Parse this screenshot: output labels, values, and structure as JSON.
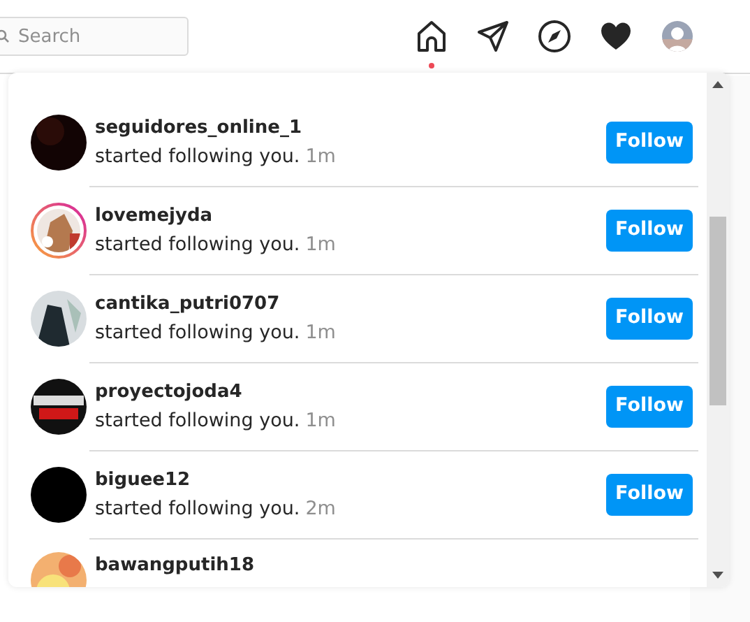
{
  "search": {
    "placeholder": "Search"
  },
  "nav": {
    "home_notification": true
  },
  "notifications": [
    {
      "username": "seguidores_online_1",
      "text": "started following you.",
      "time": "1m",
      "story_ring": false,
      "button": "Follow"
    },
    {
      "username": "lovemejyda",
      "text": "started following you.",
      "time": "1m",
      "story_ring": true,
      "button": "Follow"
    },
    {
      "username": "cantika_putri0707",
      "text": "started following you.",
      "time": "1m",
      "story_ring": false,
      "button": "Follow"
    },
    {
      "username": "proyectojoda4",
      "text": "started following you.",
      "time": "1m",
      "story_ring": false,
      "button": "Follow"
    },
    {
      "username": "biguee12",
      "text": "started following you.",
      "time": "2m",
      "story_ring": false,
      "button": "Follow"
    },
    {
      "username": "bawangputih18",
      "story_ring": false
    }
  ]
}
